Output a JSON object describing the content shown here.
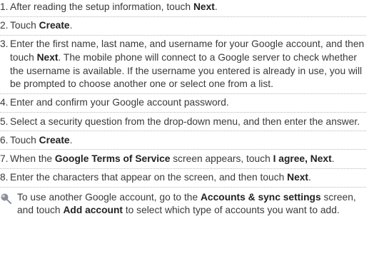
{
  "steps": [
    {
      "num": "1.",
      "segments": [
        {
          "text": "After reading the setup information, touch ",
          "bold": false
        },
        {
          "text": "Next",
          "bold": true
        },
        {
          "text": ".",
          "bold": false
        }
      ]
    },
    {
      "num": "2.",
      "segments": [
        {
          "text": "Touch ",
          "bold": false
        },
        {
          "text": "Create",
          "bold": true
        },
        {
          "text": ".",
          "bold": false
        }
      ]
    },
    {
      "num": "3.",
      "segments": [
        {
          "text": "Enter the first name, last name, and username for your Google account, and then touch ",
          "bold": false
        },
        {
          "text": "Next",
          "bold": true
        },
        {
          "text": ". The mobile phone will connect to a Google server to check whether the username is available. If the username you entered is already in use, you will be prompted to choose another one or select one from a list.",
          "bold": false
        }
      ]
    },
    {
      "num": "4.",
      "segments": [
        {
          "text": "Enter and confirm your Google account password.",
          "bold": false
        }
      ]
    },
    {
      "num": "5.",
      "segments": [
        {
          "text": "Select a security question from the drop-down menu, and then enter the answer.",
          "bold": false
        }
      ]
    },
    {
      "num": "6.",
      "segments": [
        {
          "text": "Touch ",
          "bold": false
        },
        {
          "text": "Create",
          "bold": true
        },
        {
          "text": ".",
          "bold": false
        }
      ]
    },
    {
      "num": "7.",
      "segments": [
        {
          "text": "When the ",
          "bold": false
        },
        {
          "text": "Google Terms of Service",
          "bold": true
        },
        {
          "text": " screen appears, touch ",
          "bold": false
        },
        {
          "text": "I agree, Next",
          "bold": true
        },
        {
          "text": ".",
          "bold": false
        }
      ]
    },
    {
      "num": "8.",
      "segments": [
        {
          "text": "Enter the characters that appear on the screen, and then touch ",
          "bold": false
        },
        {
          "text": "Next",
          "bold": true
        },
        {
          "text": ".",
          "bold": false
        }
      ]
    }
  ],
  "note": {
    "icon": "tip-pin-icon",
    "segments": [
      {
        "text": "To use another Google account, go to the ",
        "bold": false
      },
      {
        "text": "Accounts & sync settings",
        "bold": true
      },
      {
        "text": " screen, and touch ",
        "bold": false
      },
      {
        "text": "Add account",
        "bold": true
      },
      {
        "text": " to select which type of accounts you want to add.",
        "bold": false
      }
    ]
  },
  "colors": {
    "text": "#3a3a3a",
    "bold_text": "#222222",
    "separator": "#b9b9b9",
    "icon": "#8a8f99"
  }
}
